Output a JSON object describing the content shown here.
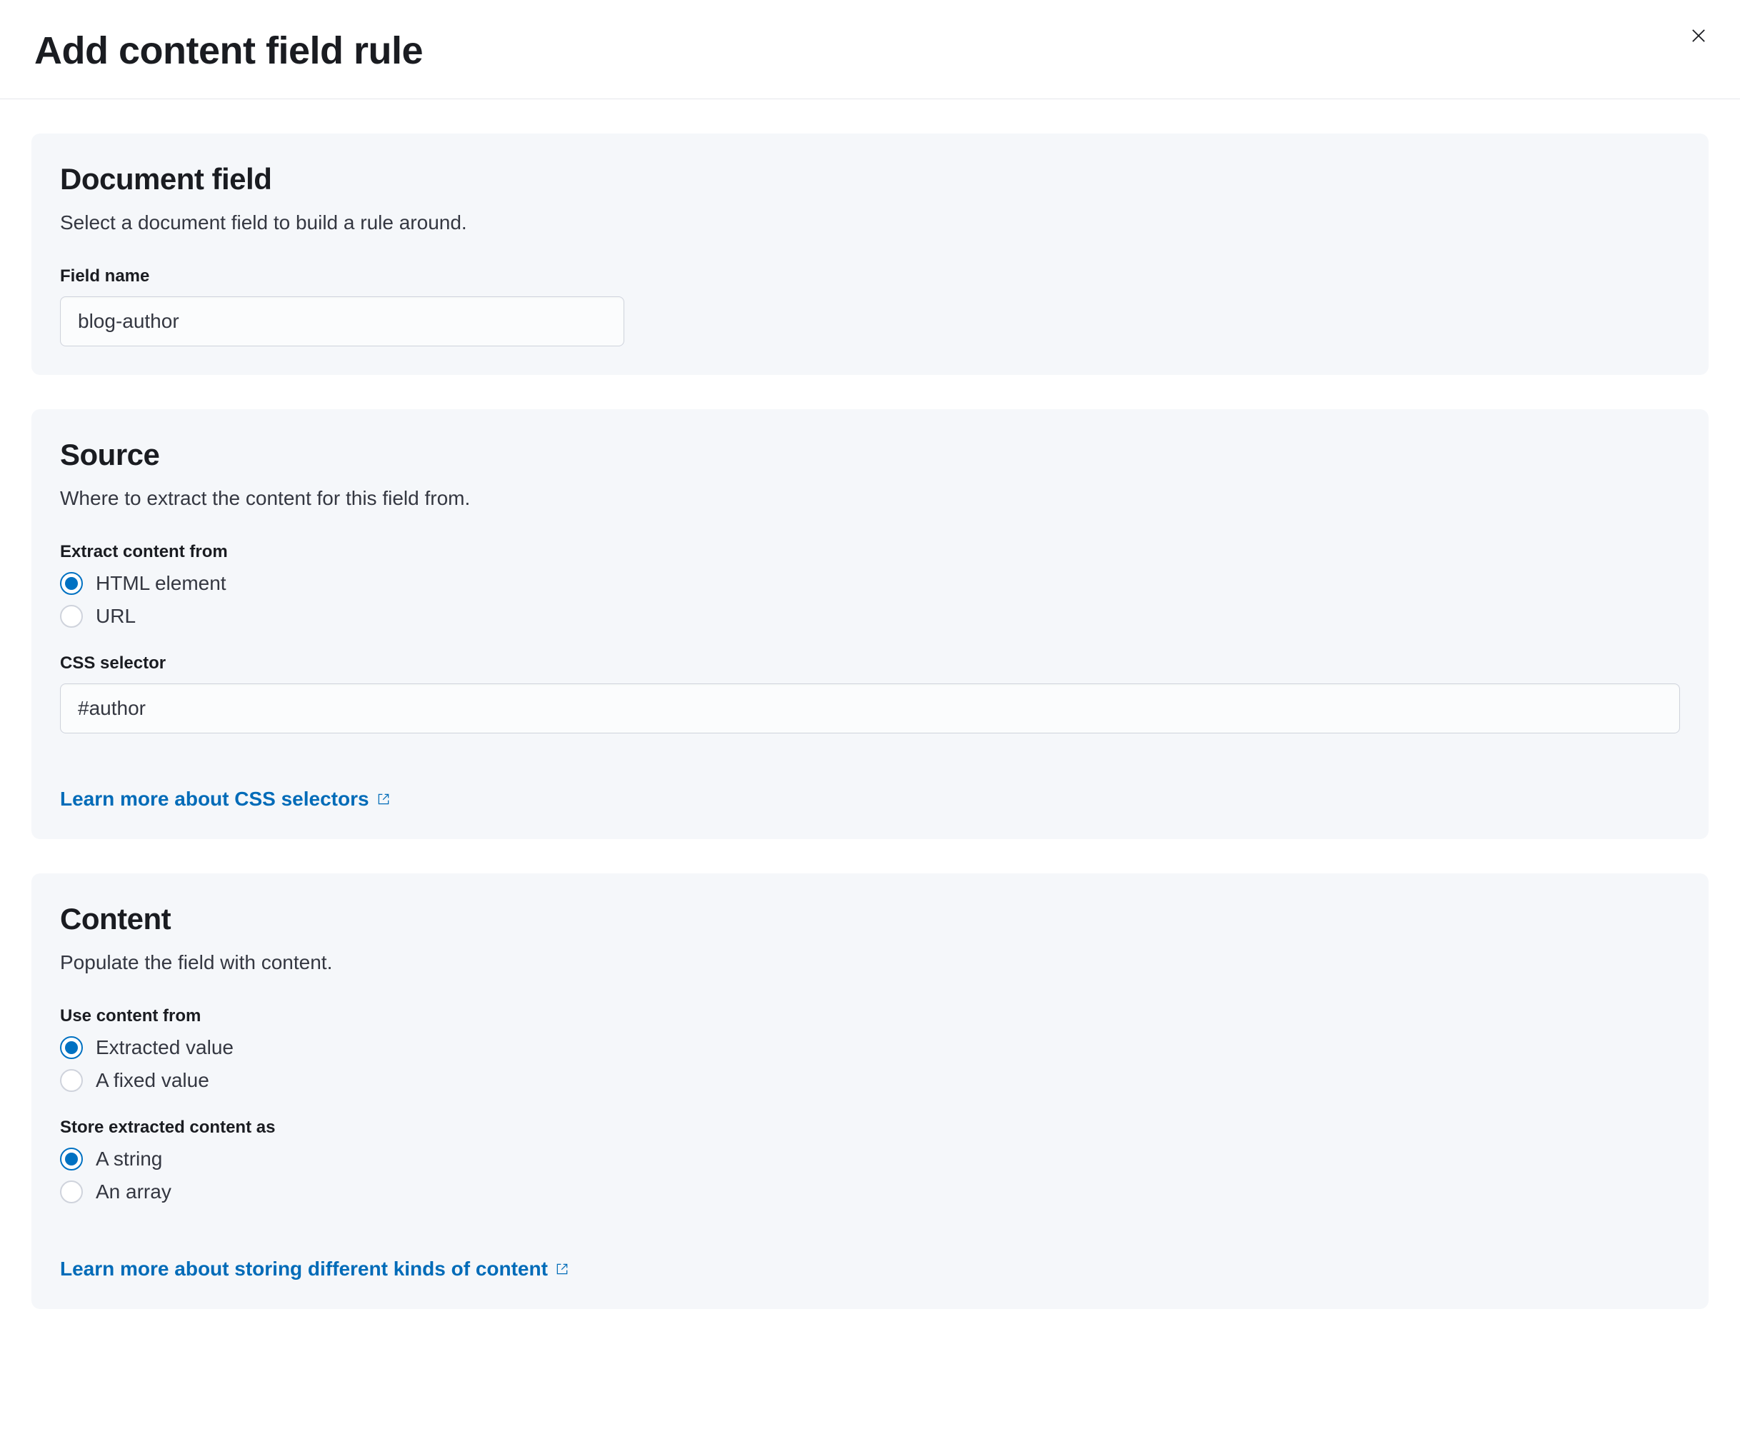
{
  "header": {
    "title": "Add content field rule"
  },
  "panels": {
    "documentField": {
      "title": "Document field",
      "description": "Select a document field to build a rule around.",
      "fieldName": {
        "label": "Field name",
        "value": "blog-author"
      }
    },
    "source": {
      "title": "Source",
      "description": "Where to extract the content for this field from.",
      "extractFrom": {
        "label": "Extract content from",
        "options": {
          "html": "HTML element",
          "url": "URL"
        },
        "selected": "html"
      },
      "cssSelector": {
        "label": "CSS selector",
        "value": "#author"
      },
      "learnMore": "Learn more about CSS selectors"
    },
    "content": {
      "title": "Content",
      "description": "Populate the field with content.",
      "useContentFrom": {
        "label": "Use content from",
        "options": {
          "extracted": "Extracted value",
          "fixed": "A fixed value"
        },
        "selected": "extracted"
      },
      "storeAs": {
        "label": "Store extracted content as",
        "options": {
          "string": "A string",
          "array": "An array"
        },
        "selected": "string"
      },
      "learnMore": "Learn more about storing different kinds of content"
    }
  }
}
